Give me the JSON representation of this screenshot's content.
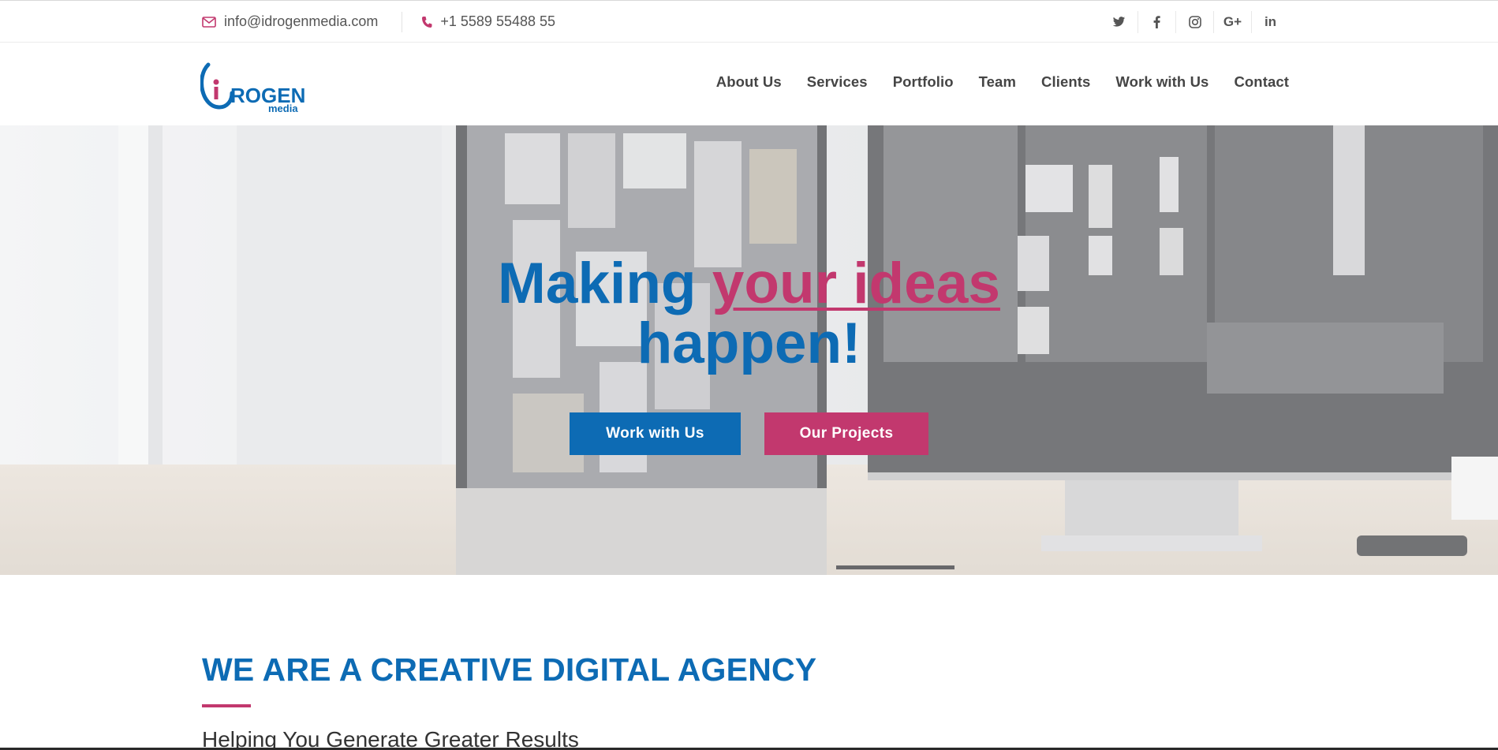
{
  "topbar": {
    "email": "info@idrogenmedia.com",
    "email_icon": "envelope-icon",
    "phone": "+1 5589 55488 55",
    "phone_icon": "phone-icon",
    "social": [
      {
        "name": "twitter-icon",
        "glyph": "t"
      },
      {
        "name": "facebook-icon",
        "glyph": "f"
      },
      {
        "name": "instagram-icon",
        "glyph": "ig"
      },
      {
        "name": "google-plus-icon",
        "glyph": "G+"
      },
      {
        "name": "linkedin-icon",
        "glyph": "in"
      }
    ]
  },
  "header": {
    "logo": {
      "word": "ROGEN",
      "sub": "media"
    },
    "nav": [
      "About Us",
      "Services",
      "Portfolio",
      "Team",
      "Clients",
      "Work with Us",
      "Contact"
    ]
  },
  "hero": {
    "title_start": "Making ",
    "title_accent": "your ideas",
    "title_end": "happen!",
    "primary_button": "Work with Us",
    "secondary_button": "Our Projects"
  },
  "about": {
    "heading": "WE ARE A CREATIVE DIGITAL AGENCY",
    "subheading": "Helping You Generate Greater Results"
  },
  "colors": {
    "brand_blue": "#0d6bb4",
    "brand_pink": "#c2386e"
  }
}
